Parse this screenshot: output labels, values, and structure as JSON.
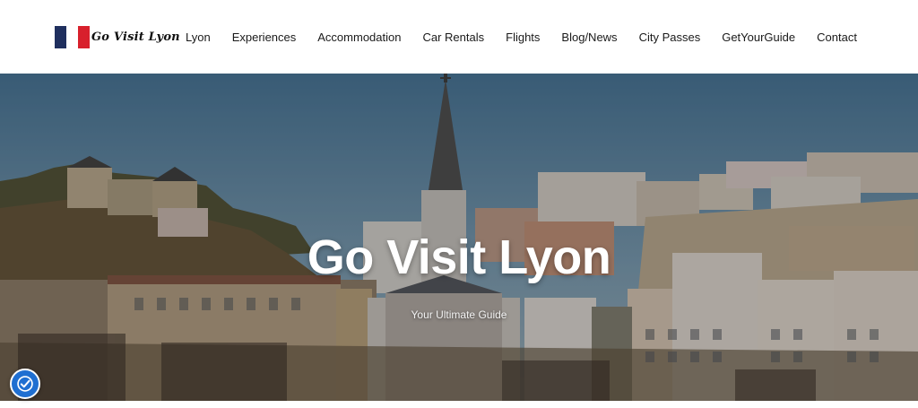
{
  "header": {
    "logo": {
      "text": "Go Visit Lyon",
      "flag_colors": [
        "#1f2f5e",
        "#ffffff",
        "#d8202c"
      ]
    },
    "nav": [
      {
        "label": "Lyon",
        "name": "nav-lyon"
      },
      {
        "label": "Experiences",
        "name": "nav-experiences"
      },
      {
        "label": "Accommodation",
        "name": "nav-accommodation"
      },
      {
        "label": "Car Rentals",
        "name": "nav-car-rentals"
      },
      {
        "label": "Flights",
        "name": "nav-flights"
      },
      {
        "label": "Blog/News",
        "name": "nav-blog-news"
      },
      {
        "label": "City Passes",
        "name": "nav-city-passes"
      },
      {
        "label": "GetYourGuide",
        "name": "nav-getyourguide"
      },
      {
        "label": "Contact",
        "name": "nav-contact"
      }
    ]
  },
  "hero": {
    "title": "Go Visit Lyon",
    "subtitle": "Your Ultimate Guide",
    "background_image": "lyon-cityscape-cathedral-photo"
  },
  "accessibility": {
    "icon": "accessibility-icon",
    "color": "#1f6fd1"
  }
}
